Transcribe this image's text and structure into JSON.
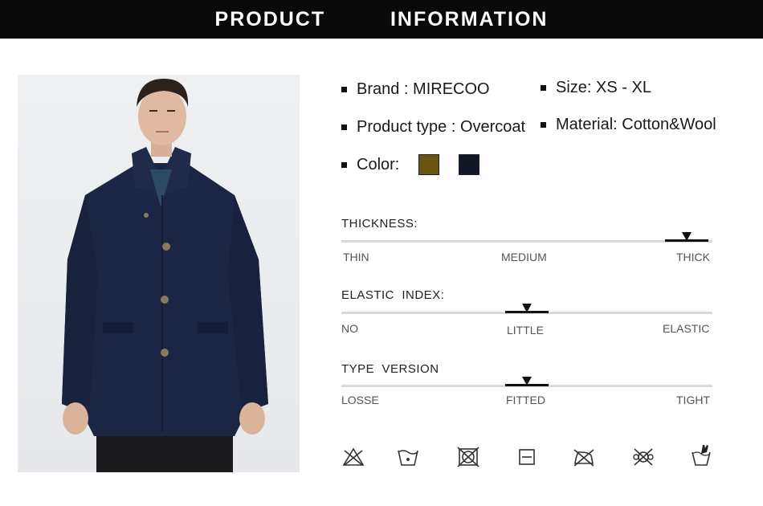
{
  "header": {
    "title": "PRODUCT   INFORMATION"
  },
  "specs": {
    "brand": "Brand : MIRECOO",
    "size": "Size: XS - XL",
    "product_type": "Product type : Overcoat",
    "material": "Material: Cotton&Wool",
    "color_label": "Color:",
    "colors": [
      "#6b5410",
      "#111626"
    ]
  },
  "scales": {
    "thickness": {
      "title": "THICKNESS:",
      "labels": [
        "THIN",
        "MEDIUM",
        "THICK"
      ],
      "selected": "THICK",
      "level": 0.93
    },
    "elastic": {
      "title": "ELASTIC  INDEX:",
      "labels": [
        "NO",
        "LITTLE",
        "ELASTIC"
      ],
      "selected": "LITTLE",
      "level": 0.5
    },
    "type_version": {
      "title": "TYPE  VERSION",
      "labels": [
        "LOSSE",
        "FITTED",
        "TIGHT"
      ],
      "selected": "FITTED",
      "level": 0.5
    }
  },
  "care_icons": [
    "do-not-bleach-icon",
    "hand-wash-icon",
    "do-not-tumble-dry-icon",
    "dry-flat-icon",
    "do-not-iron-icon",
    "do-not-dry-clean-icon",
    "hand-wash-glove-icon"
  ]
}
